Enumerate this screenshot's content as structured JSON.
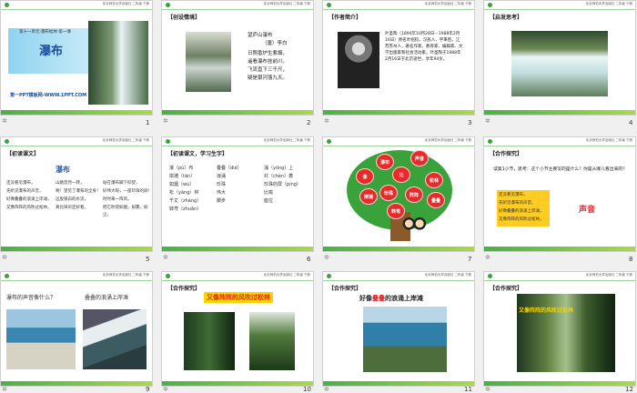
{
  "header": "北京师范大学出版社 二年级 下册",
  "star": "✲",
  "slides": [
    {
      "num": "1",
      "unit": "第十一单元·瀑布松林·第一课",
      "title": "瀑布",
      "footer": "第一PPT模板网-WWW.1PPT.COM"
    },
    {
      "num": "2",
      "tag": "【创设情境】",
      "poem_title": "望庐山瀑布",
      "poem_author": "（唐）李白",
      "lines": [
        "日照香炉生紫烟，",
        "遥看瀑布挂前川。",
        "飞流直下三千尺，",
        "疑是银河落九天。"
      ]
    },
    {
      "num": "3",
      "tag": "【作者简介】",
      "bio": "叶圣陶（1894年10月28日－1988年2月16日）原名叶绍钧，汉族人，字秉臣。江苏苏州人，著名作家、教育家、编辑家、文学出版家和社会活动家。叶圣陶于1988年2月16日于北京逝世，享年94岁。"
    },
    {
      "num": "4",
      "tag": "【启发思考】"
    },
    {
      "num": "5",
      "tag": "【初读课文】",
      "title": "瀑布",
      "text": [
        "还没看见瀑布，",
        "先听见瀑布的声音，",
        "好像叠叠的浪涌上岸滩，",
        "又像阵阵的风吹过松林。"
      ],
      "text2": [
        "山路忽然一转，",
        "啊！望见了瀑布的全身！",
        "这股银白的水流，",
        "真比珠帘还好看。"
      ],
      "text3": [
        "站在瀑布脚下仰望，",
        "好伟大呀，一座珍珠的屏！",
        "时时来一阵风，",
        "把它吹得如烟，如雾，如尘。"
      ]
    },
    {
      "num": "6",
      "tag": "【初读课文，学习生字】",
      "words": [
        "瀑（pù）布",
        "叠叠（dié）",
        "涌（yǒng）上",
        "岸滩（tān）",
        "浪涌",
        "衬（chèn）着",
        "如烟（wù）",
        "珍珠",
        "珍珠的屏（píng）",
        "松（yāng）林",
        "伟大",
        "比喻",
        "千丈（zhàng）",
        "脚步",
        "座位",
        "转弯（zhuǎn）"
      ]
    },
    {
      "num": "7",
      "leaves": [
        "瀑布",
        "声音",
        "像",
        "比",
        "松林",
        "岸滩",
        "珍珠",
        "阵阵",
        "叠叠",
        "转弯"
      ]
    },
    {
      "num": "8",
      "tag": "【合作探究】",
      "question": "读第1小节，思考：这个小节主要写的是什么？你是从哪儿看出来的？",
      "box_lines": [
        "还没看见瀑布，",
        "先听见瀑布的声音，",
        "好像叠叠的浪涌上岸滩，",
        "又像阵阵的风吹过松林。"
      ],
      "answer": "声音"
    },
    {
      "num": "9",
      "q1": "瀑布的声音像什么？",
      "q2": "叠叠的浪涌上岸滩"
    },
    {
      "num": "10",
      "tag": "【合作探究】",
      "caption": "又像阵阵的风吹过松林"
    },
    {
      "num": "11",
      "tag": "【合作探究】",
      "caption_a": "好像",
      "caption_b": "叠叠",
      "caption_c": "的浪涌上岸滩"
    },
    {
      "num": "12",
      "tag": "【合作探究】",
      "caption": "又像阵阵的风吹过松林"
    }
  ]
}
